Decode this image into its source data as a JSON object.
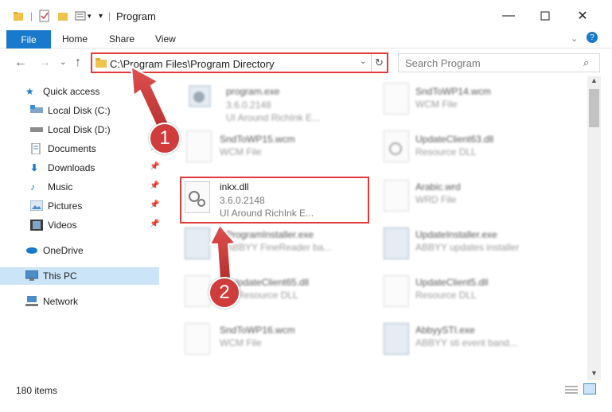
{
  "window": {
    "title": "Program"
  },
  "ribbon": {
    "file": "File",
    "home": "Home",
    "share": "Share",
    "view": "View"
  },
  "address": {
    "path": "C:\\Program Files\\Program Directory"
  },
  "search": {
    "placeholder": "Search Program"
  },
  "sidebar": {
    "items": [
      {
        "label": "Quick access"
      },
      {
        "label": "Local Disk (C:)"
      },
      {
        "label": "Local Disk (D:)"
      },
      {
        "label": "Documents"
      },
      {
        "label": "Downloads"
      },
      {
        "label": "Music"
      },
      {
        "label": "Pictures"
      },
      {
        "label": "Videos"
      },
      {
        "label": "OneDrive"
      },
      {
        "label": "This PC"
      },
      {
        "label": "Network"
      }
    ]
  },
  "files": {
    "items": [
      {
        "name": "program.exe",
        "line1": "3.6.0.2148",
        "line2": "UI Around RichInk E..."
      },
      {
        "name": "SndToWP14.wcm",
        "line1": "WCM File"
      },
      {
        "name": "SndToWP15.wcm",
        "line1": "WCM File"
      },
      {
        "name": "UpdateClient63.dll",
        "line1": "Resource DLL"
      },
      {
        "name": "inkx.dll",
        "line1": "3.6.0.2148",
        "line2": "UI Around RichInk E..."
      },
      {
        "name": "Arabic.wrd",
        "line1": "WRD File"
      },
      {
        "name": "ProgramInstaller.exe",
        "line1": "ABBYY FineReader ba..."
      },
      {
        "name": "UpdateInstaller.exe",
        "line1": "ABBYY updates installer"
      },
      {
        "name": "UpdateClient65.dll",
        "line1": "Resource DLL"
      },
      {
        "name": "UpdateClient5.dll",
        "line1": "Resource DLL"
      },
      {
        "name": "SndToWP16.wcm",
        "line1": "WCM File"
      },
      {
        "name": "AbbyySTI.exe",
        "line1": "ABBYY sti event band..."
      }
    ]
  },
  "status": {
    "count": "180 items"
  },
  "annotations": {
    "step1": "1",
    "step2": "2"
  }
}
